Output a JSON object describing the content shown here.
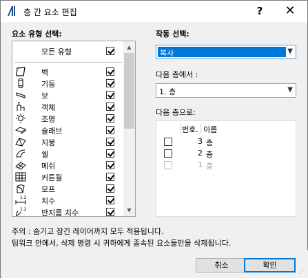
{
  "title": "층 간 요소 편집",
  "titlebar": {
    "help": "?",
    "close": "✕"
  },
  "element_type": {
    "heading": "요소 유형 선택:",
    "all_label": "모든 유형",
    "all_checked": true,
    "items": [
      {
        "label": "벽",
        "icon": "wall-icon",
        "checked": true
      },
      {
        "label": "기둥",
        "icon": "column-icon",
        "checked": true
      },
      {
        "label": "보",
        "icon": "beam-icon",
        "checked": true
      },
      {
        "label": "객체",
        "icon": "object-icon",
        "checked": true
      },
      {
        "label": "조명",
        "icon": "lamp-icon",
        "checked": true
      },
      {
        "label": "슬래브",
        "icon": "slab-icon",
        "checked": true
      },
      {
        "label": "지붕",
        "icon": "roof-icon",
        "checked": true
      },
      {
        "label": "쉘",
        "icon": "shell-icon",
        "checked": true
      },
      {
        "label": "메쉬",
        "icon": "mesh-icon",
        "checked": true
      },
      {
        "label": "커튼월",
        "icon": "curtain-wall-icon",
        "checked": true
      },
      {
        "label": "모프",
        "icon": "morph-icon",
        "checked": true
      },
      {
        "label": "치수",
        "icon": "dimension-icon",
        "checked": true
      },
      {
        "label": "반지름 치수",
        "icon": "radial-dimension-icon",
        "checked": true
      }
    ]
  },
  "operation": {
    "heading": "작동 선택:",
    "selected": "복사"
  },
  "from_floor": {
    "label": "다음 층에서 :",
    "selected": "1. 층"
  },
  "to_floors": {
    "label": "다음 층으로:",
    "col_number": "번호.",
    "col_name": "이름",
    "rows": [
      {
        "number": "3",
        "name": "층",
        "checked": false,
        "enabled": true
      },
      {
        "number": "2",
        "name": "층",
        "checked": false,
        "enabled": true
      },
      {
        "number": "1",
        "name": "층",
        "checked": false,
        "enabled": false
      }
    ]
  },
  "notes": {
    "line1": "주의 : 숨기고 잠긴 레이어까지 모두 적용됩니다.",
    "line2": "팀워크 안에서, 삭제 명령 시 귀하에게 종속된 요소들만을 삭제됩니다."
  },
  "buttons": {
    "cancel": "취소",
    "ok": "확인"
  },
  "colors": {
    "accent": "#0078d7",
    "icon_blue": "#1565c0"
  }
}
